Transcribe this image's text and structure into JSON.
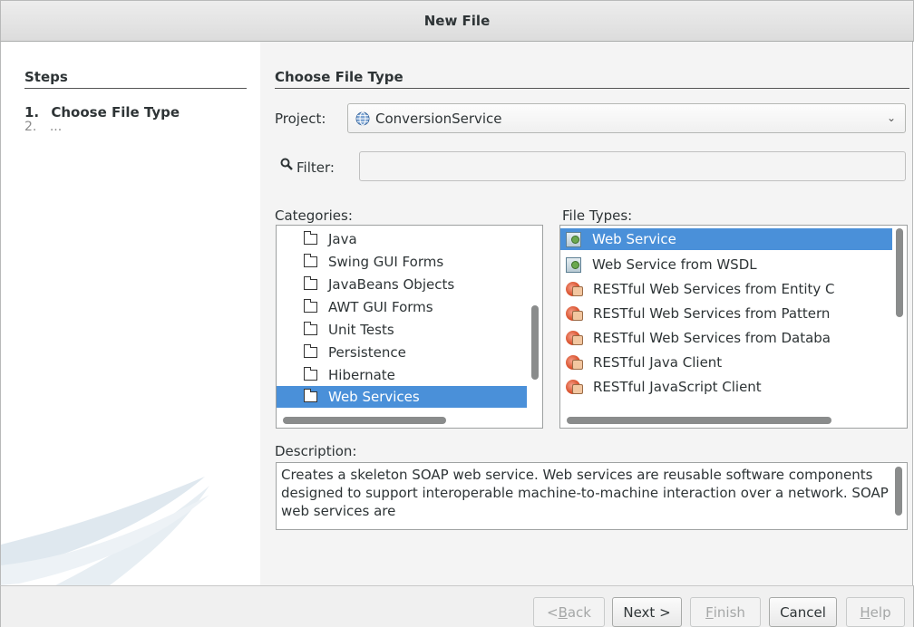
{
  "window": {
    "title": "New File"
  },
  "steps": {
    "title": "Steps",
    "items": [
      {
        "num": "1.",
        "label": "Choose File Type"
      },
      {
        "num": "2.",
        "label": "..."
      }
    ]
  },
  "panel": {
    "title": "Choose File Type",
    "project_label": "Project:",
    "project_value": "ConversionService",
    "filter_label": "Filter:",
    "filter_value": "",
    "categories_label": "Categories:",
    "file_types_label": "File Types:",
    "description_label": "Description:",
    "description_text": "Creates a skeleton SOAP web service. Web services are reusable software components designed to support interoperable machine-to-machine interaction over a network. SOAP web services are"
  },
  "categories": [
    {
      "label": "Java",
      "selected": false
    },
    {
      "label": "Swing GUI Forms",
      "selected": false
    },
    {
      "label": "JavaBeans Objects",
      "selected": false
    },
    {
      "label": "AWT GUI Forms",
      "selected": false
    },
    {
      "label": "Unit Tests",
      "selected": false
    },
    {
      "label": "Persistence",
      "selected": false
    },
    {
      "label": "Hibernate",
      "selected": false
    },
    {
      "label": "Web Services",
      "selected": true
    }
  ],
  "file_types": [
    {
      "label": "Web Service",
      "icon": "web-service-icon",
      "selected": true
    },
    {
      "label": "Web Service from WSDL",
      "icon": "web-service-icon",
      "selected": false
    },
    {
      "label": "RESTful Web Services from Entity C",
      "icon": "restful-icon",
      "selected": false
    },
    {
      "label": "RESTful Web Services from Pattern",
      "icon": "restful-icon",
      "selected": false
    },
    {
      "label": "RESTful Web Services from Databa",
      "icon": "restful-icon",
      "selected": false
    },
    {
      "label": "RESTful Java Client",
      "icon": "restful-icon",
      "selected": false
    },
    {
      "label": "RESTful JavaScript Client",
      "icon": "restful-icon",
      "selected": false
    }
  ],
  "buttons": {
    "back": {
      "prefix": "< ",
      "mnemonic": "B",
      "rest": "ack"
    },
    "next": "Next >",
    "finish": {
      "mnemonic": "F",
      "rest": "inish"
    },
    "cancel": "Cancel",
    "help": {
      "mnemonic": "H",
      "rest": "elp"
    }
  },
  "colors": {
    "selection": "#4a90d9",
    "panel_bg": "#f4f4f4"
  }
}
